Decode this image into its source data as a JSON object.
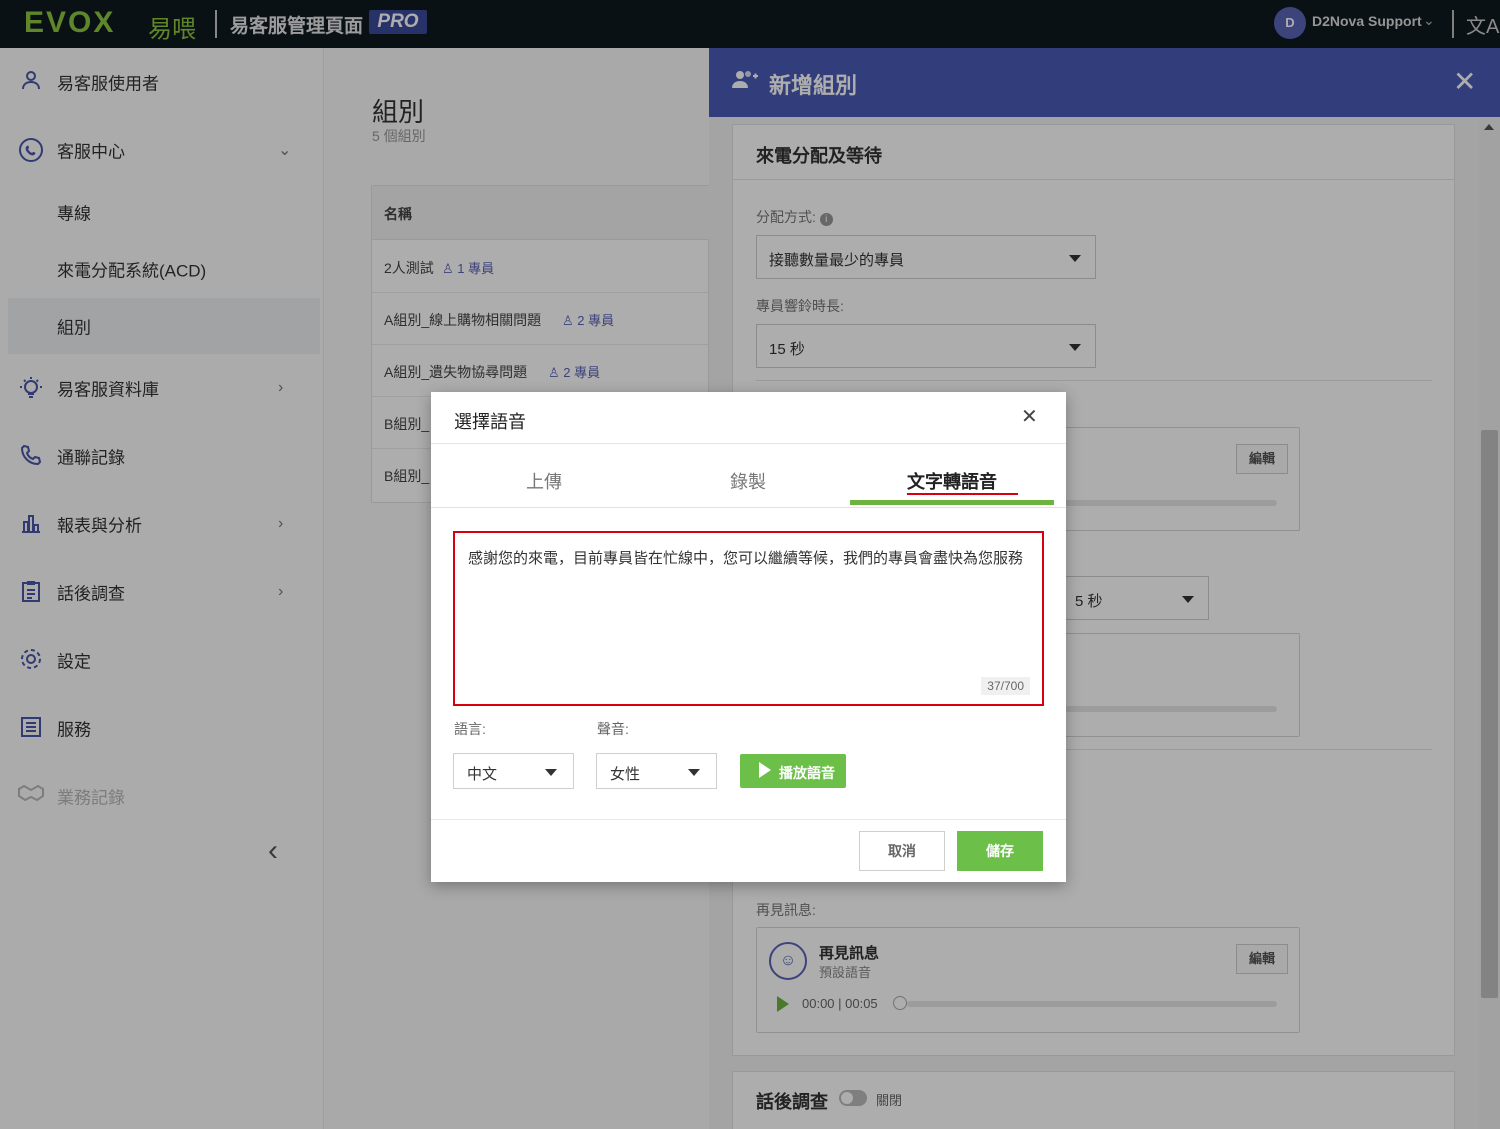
{
  "topbar": {
    "logo": "EVOX",
    "logo_cn": "易喂",
    "title": "易客服管理頁面",
    "pro": "PRO",
    "user_initial": "D",
    "user_name": "D2Nova Support"
  },
  "sidebar": {
    "items": [
      {
        "label": "易客服使用者"
      },
      {
        "label": "客服中心"
      },
      {
        "label": "專線"
      },
      {
        "label": "來電分配系統(ACD)"
      },
      {
        "label": "組別"
      },
      {
        "label": "易客服資料庫"
      },
      {
        "label": "通聯記錄"
      },
      {
        "label": "報表與分析"
      },
      {
        "label": "話後調查"
      },
      {
        "label": "設定"
      },
      {
        "label": "服務"
      },
      {
        "label": "業務記錄"
      }
    ]
  },
  "main": {
    "title": "組別",
    "subtitle": "5 個組別",
    "table_header": "名稱",
    "rows": [
      {
        "name": "2人測試",
        "count": "1 專員"
      },
      {
        "name": "A組別_線上購物相關問題",
        "count": "2 專員"
      },
      {
        "name": "A組別_遺失物協尋問題",
        "count": "2 專員"
      },
      {
        "name": "B組別_",
        "count": ""
      },
      {
        "name": "B組別_",
        "count": ""
      }
    ]
  },
  "drawer": {
    "title": "新增組別",
    "section_title": "來電分配及等待",
    "distribution_label": "分配方式:",
    "distribution_value": "接聽數量最少的專員",
    "ring_label": "專員響鈴時長:",
    "ring_value": "15 秒",
    "edit_label": "編輯",
    "partial_select_value": "5 秒",
    "goodbye_label": "再見訊息:",
    "goodbye_title": "再見訊息",
    "goodbye_sub": "預設語音",
    "goodbye_time": "00:00 | 00:05",
    "survey_title": "話後調查",
    "survey_state": "關閉"
  },
  "modal": {
    "title": "選擇語音",
    "tabs": [
      "上傳",
      "錄製",
      "文字轉語音"
    ],
    "active_tab": 2,
    "tts_text": "感謝您的來電，目前專員皆在忙線中，您可以繼續等候，我們的專員會盡快為您服務",
    "char_count": "37/700",
    "language_label": "語言:",
    "language_value": "中文",
    "voice_label": "聲音:",
    "voice_value": "女性",
    "play_label": "播放語音",
    "cancel_label": "取消",
    "save_label": "儲存"
  },
  "colors": {
    "accent_blue": "#4a5ab5",
    "accent_green": "#6cc04a",
    "highlight_red": "#d9000d",
    "topbar_bg": "#0f1a20"
  }
}
